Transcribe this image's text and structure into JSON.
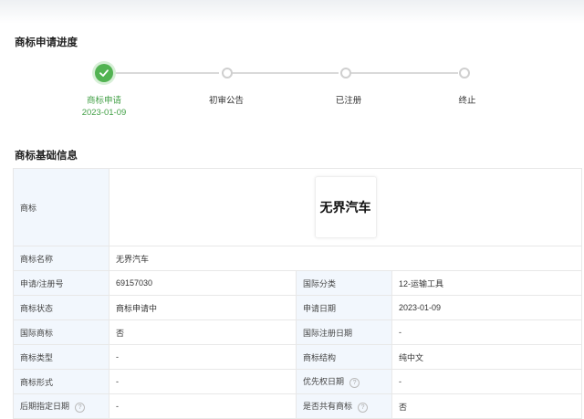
{
  "progress": {
    "title": "商标申请进度",
    "steps": [
      {
        "label": "商标申请",
        "date": "2023-01-09",
        "status": "done"
      },
      {
        "label": "初审公告",
        "date": "",
        "status": "pending"
      },
      {
        "label": "已注册",
        "date": "",
        "status": "pending"
      },
      {
        "label": "终止",
        "date": "",
        "status": "pending"
      }
    ]
  },
  "basic_info": {
    "title": "商标基础信息",
    "trademark_label": "商标",
    "trademark_image_text": "无界汽车",
    "name_label": "商标名称",
    "name_value": "无界汽车",
    "rows": [
      {
        "k1": "申请/注册号",
        "v1": "69157030",
        "k2": "国际分类",
        "v2": "12-运输工具"
      },
      {
        "k1": "商标状态",
        "v1": "商标申请中",
        "k2": "申请日期",
        "v2": "2023-01-09"
      },
      {
        "k1": "国际商标",
        "v1": "否",
        "k2": "国际注册日期",
        "v2": "-"
      },
      {
        "k1": "商标类型",
        "v1": "-",
        "k2": "商标结构",
        "v2": "纯中文"
      },
      {
        "k1": "商标形式",
        "v1": "-",
        "k2": "优先权日期",
        "v2": "-"
      },
      {
        "k1": "后期指定日期",
        "v1": "-",
        "k2": "是否共有商标",
        "v2": "否"
      }
    ]
  },
  "colors": {
    "accent": "#52b352",
    "key_bg": "#f2f7fd"
  }
}
